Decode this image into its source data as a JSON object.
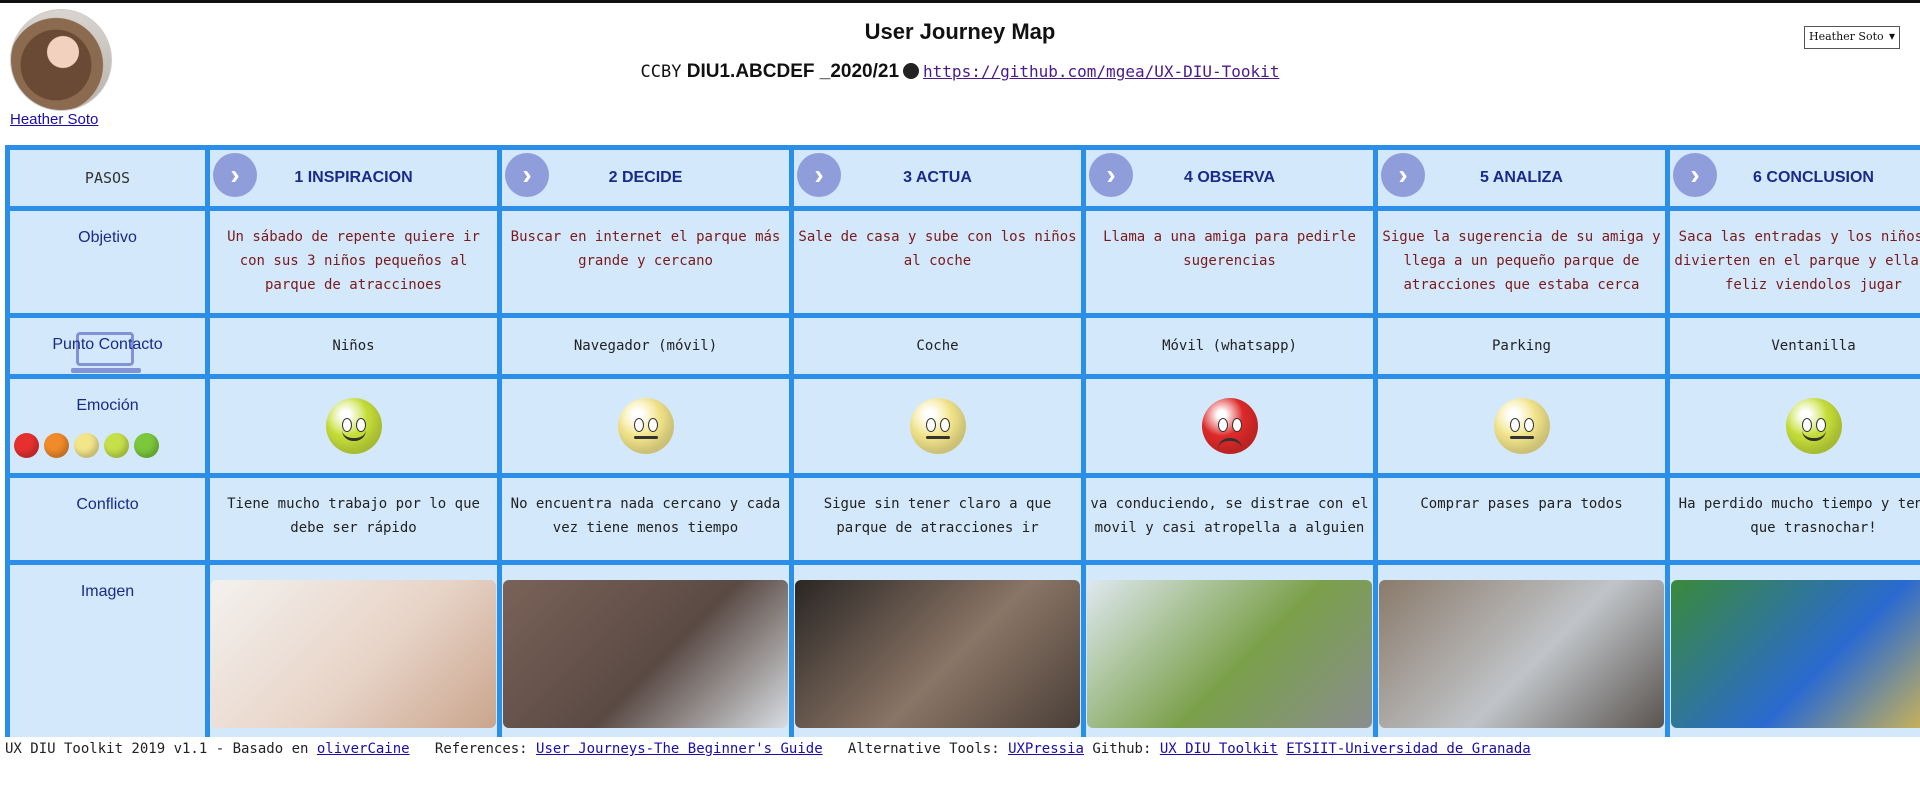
{
  "header": {
    "user_name": "Heather Soto",
    "title": "User Journey Map",
    "cc": "CCBY",
    "course": "DIU1.ABCDEF _2020/21",
    "repo_link": "https://github.com/mgea/UX-DIU-Tookit",
    "user_select_value": "Heather Soto"
  },
  "rows": {
    "pasos": "PASOS",
    "objetivo": "Objetivo",
    "punto_contacto": "Punto Contacto",
    "emocion": "Emoción",
    "conflicto": "Conflicto",
    "imagen": "Imagen"
  },
  "emotion_scale_colors": [
    "#e63030",
    "#f08a2a",
    "#f3e58a",
    "#c6e04a",
    "#7bc83c"
  ],
  "steps": [
    {
      "title": "1 INSPIRACION",
      "objetivo": "Un sábado de repente quiere ir con sus 3 niños pequeños al parque de atraccinoes",
      "contacto": "Niños",
      "emotion": "happy",
      "emotion_color": "#c8e03a",
      "conflicto": "Tiene mucho trabajo por lo que debe ser rápido",
      "image_colors": [
        "#f3f1ee",
        "#e8d4c8",
        "#c9a58d"
      ]
    },
    {
      "title": "2 DECIDE",
      "objetivo": "Buscar en internet el parque más grande y cercano",
      "contacto": "Navegador (móvil)",
      "emotion": "neutral",
      "emotion_color": "#f4e68c",
      "conflicto": "No encuentra nada cercano y cada vez tiene menos tiempo",
      "image_colors": [
        "#7a6258",
        "#5a4a44",
        "#d8dde2"
      ]
    },
    {
      "title": "3 ACTUA",
      "objetivo": "Sale de casa y sube con los niños al coche",
      "contacto": "Coche",
      "emotion": "neutral",
      "emotion_color": "#f4e68c",
      "conflicto": "Sigue sin tener claro a que parque de atracciones ir",
      "image_colors": [
        "#2a2624",
        "#8a7566",
        "#4a3f38"
      ]
    },
    {
      "title": "4 OBSERVA",
      "objetivo": "Llama a una amiga para pedirle sugerencias",
      "contacto": "Móvil (whatsapp)",
      "emotion": "angry",
      "emotion_color": "#e02a2a",
      "conflicto": "va conduciendo, se distrae con el movil y casi atropella a alguien",
      "image_colors": [
        "#dfe8f0",
        "#7aa04a",
        "#8a8d90"
      ]
    },
    {
      "title": "5 ANALIZA",
      "objetivo": "Sigue la sugerencia de su amiga y llega a un pequeño parque de atracciones que estaba cerca",
      "contacto": "Parking",
      "emotion": "neutral",
      "emotion_color": "#f4e68c",
      "conflicto": "Comprar pases para todos",
      "image_colors": [
        "#8a7a6a",
        "#c0c4c8",
        "#5a5450"
      ]
    },
    {
      "title": "6 CONCLUSION",
      "objetivo": "Saca las entradas y los niños se divierten en el parque y ellas es feliz viendolos jugar",
      "contacto": "Ventanilla",
      "emotion": "happy",
      "emotion_color": "#c8e03a",
      "conflicto": "Ha perdido mucho tiempo y tendrá que trasnochar!",
      "image_colors": [
        "#3a8a3a",
        "#2a6ad0",
        "#e8c040"
      ]
    }
  ],
  "footer": {
    "text1": "UX DIU Toolkit 2019 v1.1 - Basado en",
    "link1": "oliverCaine",
    "text2": "References:",
    "link2": "User Journeys-The Beginner's Guide",
    "text3": "Alternative Tools:",
    "link3": "UXPressia",
    "text4": "Github:",
    "link4": "UX DIU Toolkit",
    "link5": "ETSIIT-Universidad de Granada"
  }
}
